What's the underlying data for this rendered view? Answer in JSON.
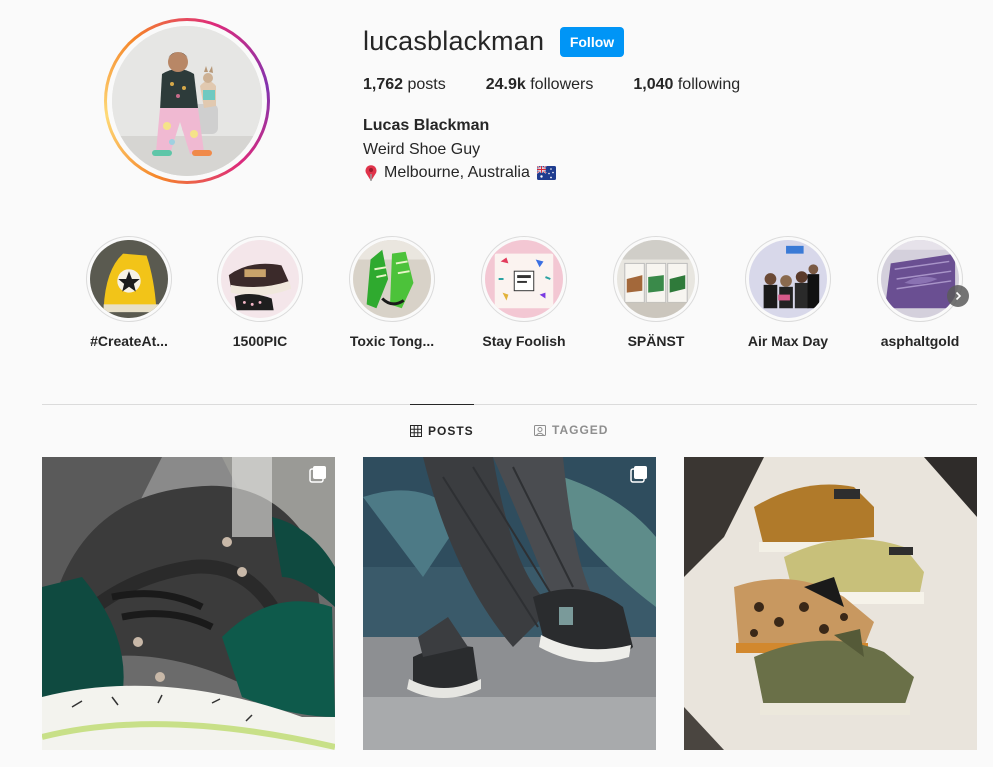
{
  "profile": {
    "username": "lucasblackman",
    "follow_label": "Follow",
    "stats": {
      "posts_count": "1,762",
      "posts_label": " posts",
      "followers_count": "24.9k",
      "followers_label": " followers",
      "following_count": "1,040",
      "following_label": " following"
    },
    "full_name": "Lucas Blackman",
    "bio": "Weird Shoe Guy",
    "location": "Melbourne, Australia",
    "location_icon": "pin-icon",
    "flag_icon": "australia-flag-icon"
  },
  "highlights": [
    {
      "label": "#CreateAt..."
    },
    {
      "label": "1500PIC"
    },
    {
      "label": "Toxic Tong..."
    },
    {
      "label": "Stay Foolish"
    },
    {
      "label": "SPÄNST"
    },
    {
      "label": "Air Max Day"
    },
    {
      "label": "asphaltgold"
    }
  ],
  "tabs": [
    {
      "label": "POSTS",
      "icon": "grid-icon",
      "active": true
    },
    {
      "label": "TAGGED",
      "icon": "tagged-icon",
      "active": false
    }
  ],
  "posts": [
    {
      "subject": "green and grey sneaker close-up",
      "multi": true
    },
    {
      "subject": "walking sneaker on street",
      "multi": true
    },
    {
      "subject": "stack of wallabee shoes",
      "multi": false
    }
  ],
  "colors": {
    "follow_button": "#0095f6",
    "text": "#262626",
    "muted": "#8e8e8e",
    "border": "#dbdbdb",
    "background": "#fafafa"
  }
}
